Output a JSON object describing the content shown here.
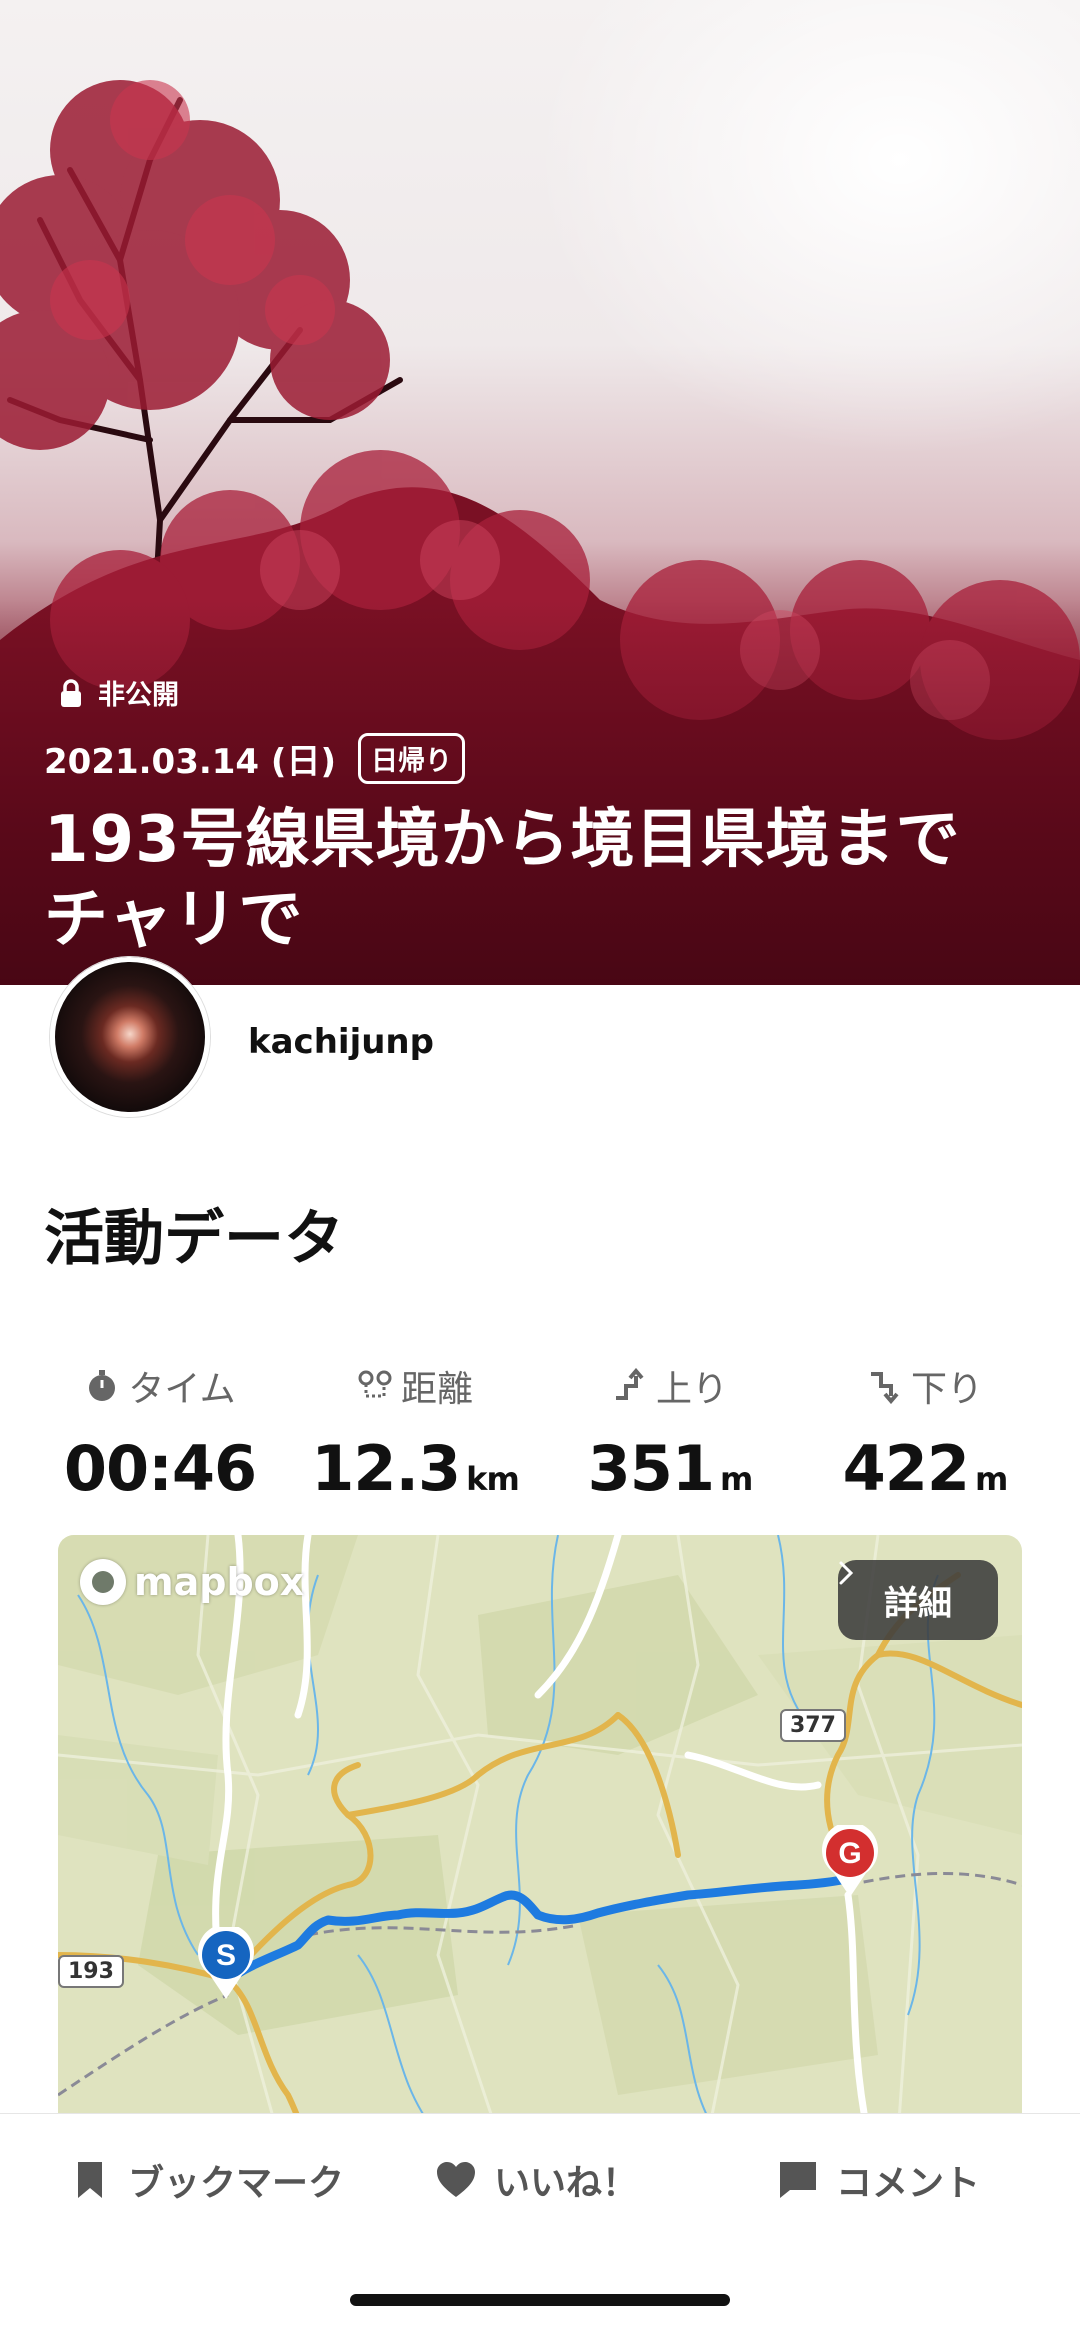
{
  "hero": {
    "privacy_label": "非公開",
    "date": "2021.03.14 (日)",
    "activity_type": "日帰り",
    "title_line1": "193号線県境から境目県境まで",
    "title_line2": "チャリで"
  },
  "user": {
    "name": "kachijunp"
  },
  "section": {
    "title": "活動データ"
  },
  "stats": [
    {
      "label": "タイム",
      "value": "00:46",
      "unit": ""
    },
    {
      "label": "距離",
      "value": "12.3",
      "unit": "km"
    },
    {
      "label": "上り",
      "value": "351",
      "unit": "m"
    },
    {
      "label": "下り",
      "value": "422",
      "unit": "m"
    }
  ],
  "map": {
    "provider": "mapbox",
    "detail_label": "詳細",
    "road_labels": [
      "377",
      "193"
    ],
    "start_marker": "S",
    "goal_marker": "G",
    "route_color": "#1e7be0",
    "start_color": "#1565c0",
    "goal_color": "#d32f2f"
  },
  "bottom_bar": {
    "bookmark": "ブックマーク",
    "like": "いいね！",
    "comment": "コメント"
  }
}
